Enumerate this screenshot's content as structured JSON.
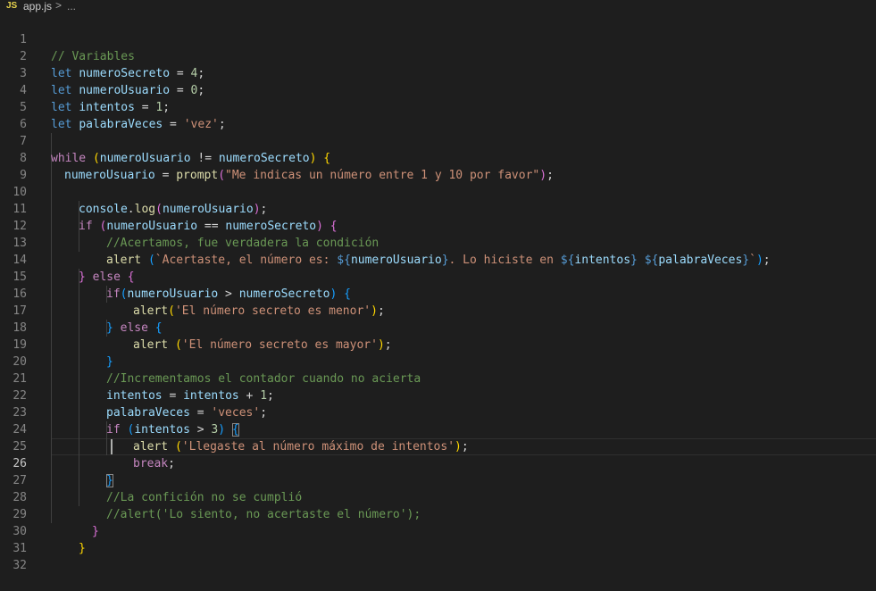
{
  "breadcrumb": {
    "language_badge": "JS",
    "file_name": "app.js",
    "separator": ">",
    "more": "..."
  },
  "editor": {
    "active_line": 26,
    "line_numbers": [
      "1",
      "2",
      "3",
      "4",
      "5",
      "6",
      "7",
      "8",
      "9",
      "10",
      "11",
      "12",
      "13",
      "14",
      "15",
      "16",
      "17",
      "18",
      "19",
      "20",
      "21",
      "22",
      "23",
      "24",
      "25",
      "26",
      "27",
      "28",
      "29",
      "30",
      "31",
      "32"
    ],
    "lines": {
      "l1": [
        "// Variables"
      ],
      "l2": [
        "let",
        "numeroSecreto",
        " = ",
        "4",
        ";"
      ],
      "l3": [
        "let",
        "numeroUsuario",
        " = ",
        "0",
        ";"
      ],
      "l4": [
        "let",
        "intentos",
        " = ",
        "1",
        ";"
      ],
      "l5": [
        "let",
        "palabraVeces",
        " = ",
        "'vez'",
        ";"
      ],
      "l7": [
        "while",
        " ",
        "(",
        "numeroUsuario",
        " != ",
        "numeroSecreto",
        ")",
        " ",
        "{"
      ],
      "l8": [
        "numeroUsuario",
        " = ",
        "prompt",
        "(",
        "\"Me indicas un número entre 1 y 10 por favor\"",
        ")",
        ";"
      ],
      "l10": [
        "console",
        ".",
        "log",
        "(",
        "numeroUsuario",
        ")",
        ";"
      ],
      "l11": [
        "if",
        " ",
        "(",
        "numeroUsuario",
        " == ",
        "numeroSecreto",
        ")",
        " ",
        "{"
      ],
      "l12": [
        "//Acertamos, fue verdadera la condición"
      ],
      "l13": [
        "alert",
        " ",
        "(",
        "`Acertaste, el número es: ",
        "${",
        "numeroUsuario",
        "}",
        ". Lo hiciste en ",
        "${",
        "intentos",
        "}",
        " ",
        "${",
        "palabraVeces",
        "}",
        "`",
        ")",
        ";"
      ],
      "l14": [
        "}",
        " ",
        "else",
        " ",
        "{"
      ],
      "l15": [
        "if",
        "(",
        "numeroUsuario",
        " > ",
        "numeroSecreto",
        ")",
        " ",
        "{"
      ],
      "l16": [
        "alert",
        "(",
        "'El número secreto es menor'",
        ")",
        ";"
      ],
      "l17": [
        "}",
        " ",
        "else",
        " ",
        "{"
      ],
      "l18": [
        "alert",
        " ",
        "(",
        "'El número secreto es mayor'",
        ")",
        ";"
      ],
      "l19": [
        "}"
      ],
      "l20": [
        "//Incrementamos el contador cuando no acierta"
      ],
      "l21": [
        "intentos",
        " = ",
        "intentos",
        " + ",
        "1",
        ";"
      ],
      "l22": [
        "palabraVeces",
        " = ",
        "'veces'",
        ";"
      ],
      "l23": [
        "if",
        " ",
        "(",
        "intentos",
        " > ",
        "3",
        ")",
        " ",
        "{"
      ],
      "l24": [
        "alert",
        " ",
        "(",
        "'Llegaste al número máximo de intentos'",
        ")",
        ";"
      ],
      "l25": [
        "break",
        ";"
      ],
      "l26": [
        "}"
      ],
      "l27": [
        "//La confición no se cumplió"
      ],
      "l28": [
        "//alert('Lo siento, no acertaste el número');"
      ],
      "l29": [
        "}"
      ],
      "l30": [
        "}"
      ]
    }
  },
  "colors": {
    "background": "#1e1e1e",
    "keyword": "#569cd6",
    "control": "#c586c0",
    "variable": "#9cdcfe",
    "function": "#dcdcaa",
    "number": "#b5cea8",
    "string": "#ce9178",
    "comment": "#6a9955",
    "bracket_level1": "#ffd700",
    "bracket_level2": "#da70d6",
    "bracket_level3": "#179fff"
  }
}
